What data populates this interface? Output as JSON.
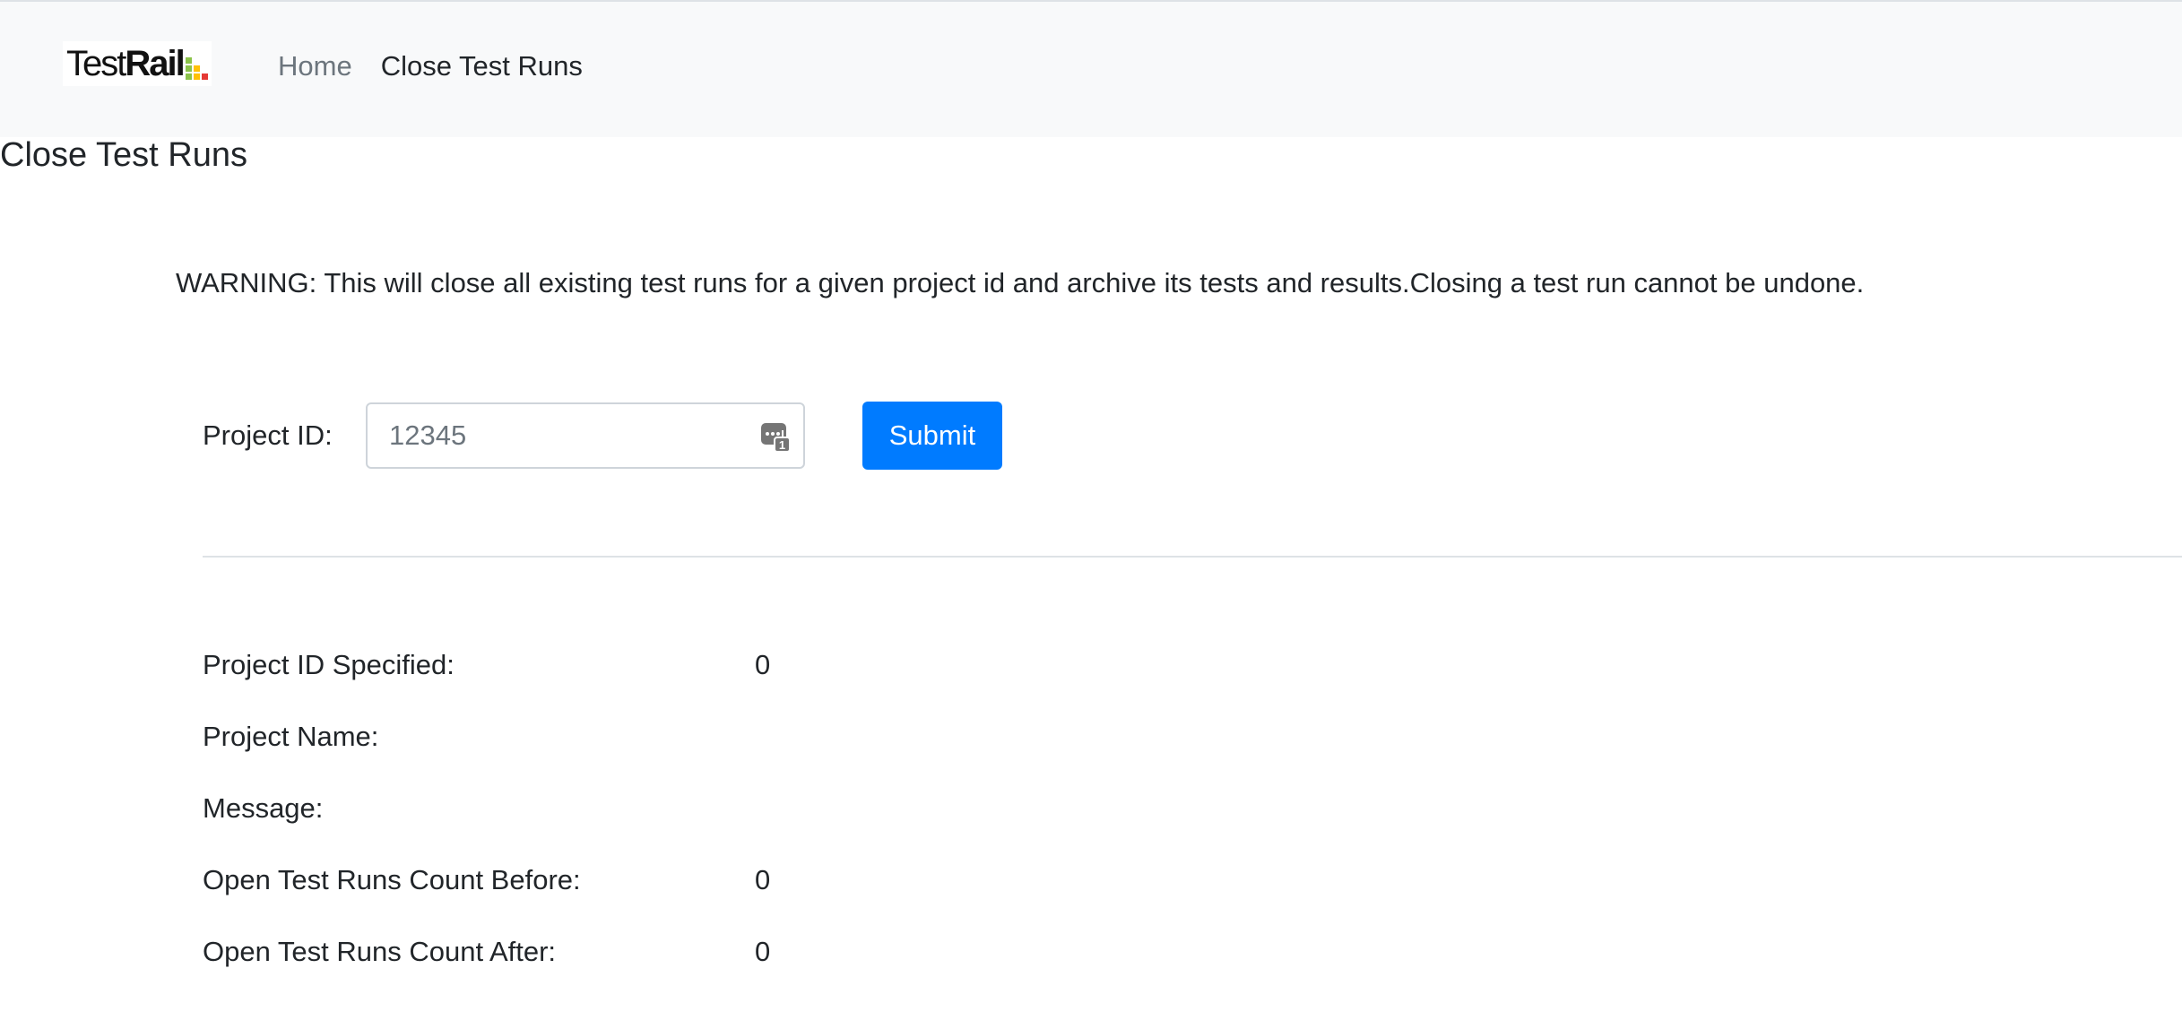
{
  "header": {
    "logo_text_light": "Test",
    "logo_text_bold": "Rail",
    "logo_colors": [
      "#8bc34a",
      "#ffc107",
      "#e53935"
    ],
    "nav": {
      "home": "Home",
      "current": "Close Test Runs"
    }
  },
  "page": {
    "title": "Close Test Runs",
    "warning": "WARNING: This will close all existing test runs for a given project id and archive its tests and results.Closing a test run cannot be undone."
  },
  "form": {
    "project_id_label": "Project ID:",
    "project_id_placeholder": "12345",
    "project_id_value": "",
    "submit_label": "Submit",
    "autofill_icon": "password-manager-icon"
  },
  "results": {
    "project_id_specified_label": "Project ID Specified:",
    "project_id_specified_value": "0",
    "project_name_label": "Project Name:",
    "project_name_value": "",
    "message_label": "Message:",
    "message_value": "",
    "open_before_label": "Open Test Runs Count Before:",
    "open_before_value": "0",
    "open_after_label": "Open Test Runs Count After:",
    "open_after_value": "0"
  },
  "colors": {
    "primary": "#007bff",
    "navbar_bg": "#f8f9fa",
    "muted": "#6c757d"
  }
}
